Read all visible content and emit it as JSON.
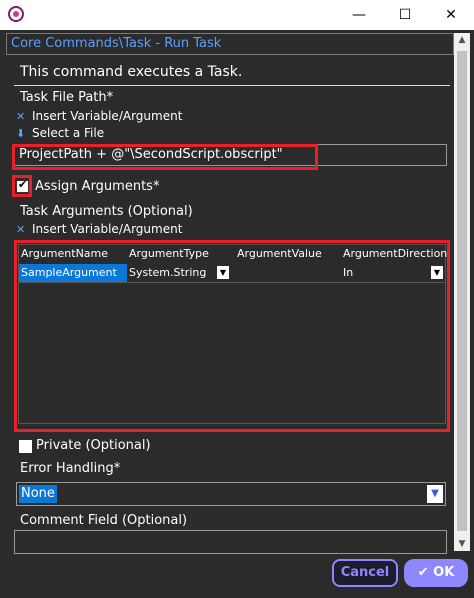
{
  "window": {
    "minimize": "—",
    "maximize": "☐",
    "close": "✕"
  },
  "command": {
    "selected": "Core Commands\\Task - Run Task",
    "description": "This command executes a Task."
  },
  "task_file": {
    "label": "Task File Path*",
    "insert_variable": "Insert Variable/Argument",
    "select_file": "Select a File",
    "value": "ProjectPath + @\"\\SecondScript.obscript\""
  },
  "assign_arguments": {
    "label": "Assign Arguments*",
    "checked": true
  },
  "task_arguments": {
    "label": "Task Arguments (Optional)",
    "insert_variable": "Insert Variable/Argument",
    "columns": [
      "ArgumentName",
      "ArgumentType",
      "ArgumentValue",
      "ArgumentDirection"
    ],
    "rows": [
      {
        "name": "SampleArgument",
        "type": "System.String",
        "value": "",
        "direction": "In"
      }
    ]
  },
  "private": {
    "label": "Private (Optional)",
    "checked": false
  },
  "error_handling": {
    "label": "Error Handling*",
    "selected": "None"
  },
  "comment": {
    "label": "Comment Field (Optional)",
    "value": ""
  },
  "buttons": {
    "cancel": "Cancel",
    "ok": "✔ OK"
  },
  "colors": {
    "accent": "#8d88ff",
    "highlight": "#e8202a",
    "selection": "#0a78d7"
  }
}
